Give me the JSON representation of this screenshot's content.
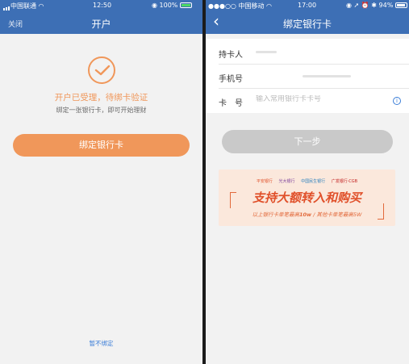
{
  "left": {
    "status": {
      "carrier": "中国联通",
      "time": "12:50",
      "battery": "100%"
    },
    "nav": {
      "close": "关闭",
      "title": "开户"
    },
    "message": "开户已受理，待绑卡验证",
    "submessage": "绑定一张银行卡，即可开始理财",
    "bind_button": "绑定银行卡",
    "skip_link": "暂不绑定"
  },
  "right": {
    "status": {
      "carrier": "●●●○○ 中国移动",
      "time": "17:00",
      "battery": "94%"
    },
    "nav": {
      "back": "‹",
      "title": "绑定银行卡"
    },
    "form": {
      "holder_label": "持卡人",
      "phone_label": "手机号",
      "card_label": "卡　号",
      "card_placeholder": "输入常用银行卡卡号"
    },
    "next_button": "下一步",
    "banner": {
      "logos": [
        "平安银行",
        "光大银行",
        "中国民生银行",
        "广发银行·CGB"
      ],
      "title": "支持大额转入和购买",
      "subtitle_pre": "以上银行卡单笔最高",
      "subtitle_bold": "10w",
      "subtitle_post": " / 其他卡单笔最高5W"
    }
  },
  "colors": {
    "header": "#3d6fb5",
    "accent": "#f0975a",
    "link": "#3d7fd8"
  }
}
